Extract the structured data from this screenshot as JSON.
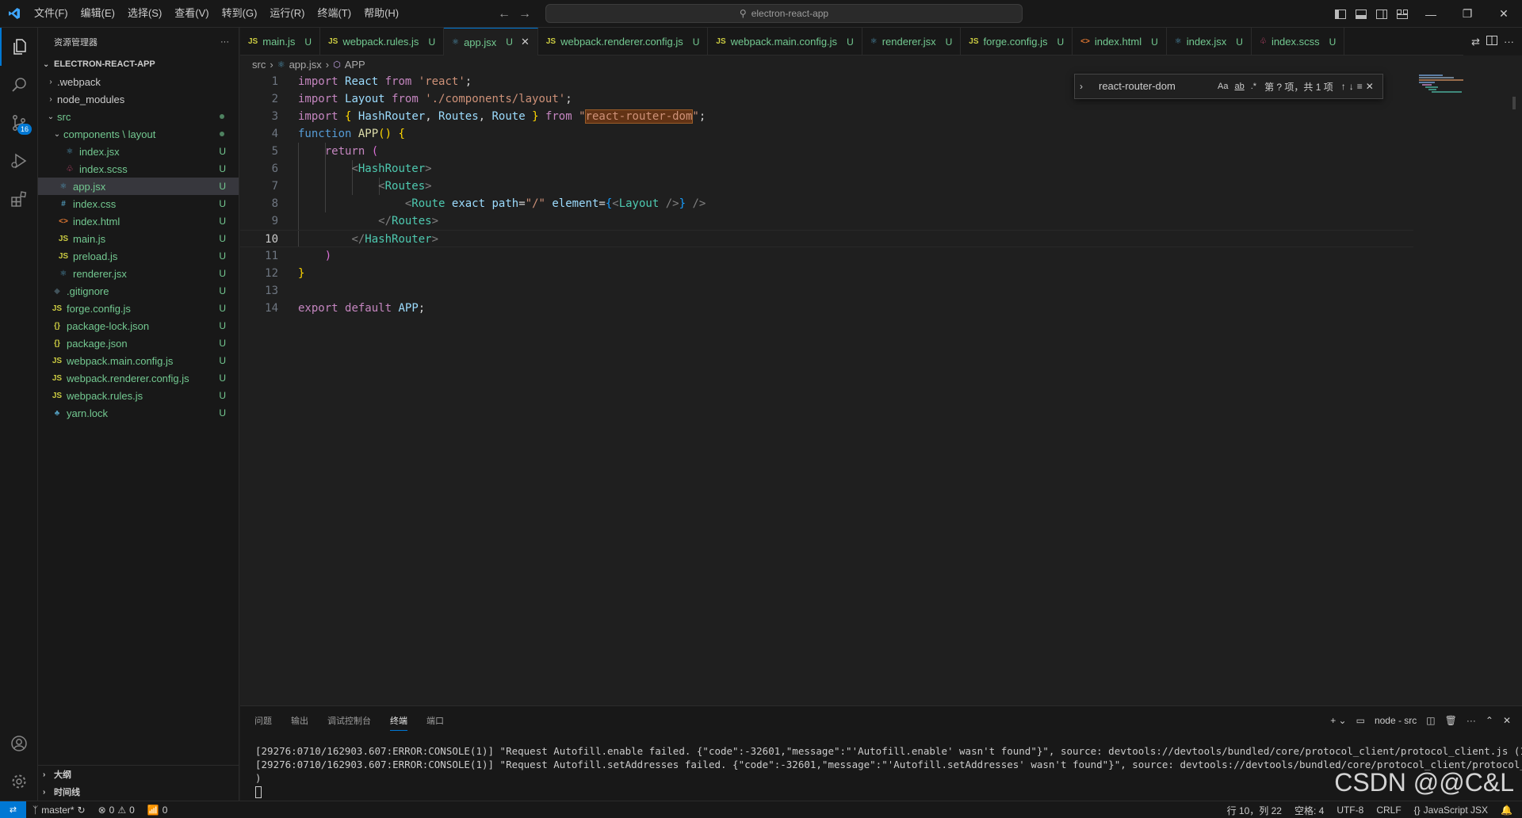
{
  "titlebar": {
    "menu": [
      "文件(F)",
      "编辑(E)",
      "选择(S)",
      "查看(V)",
      "转到(G)",
      "运行(R)",
      "终端(T)",
      "帮助(H)"
    ],
    "search": "electron-react-app"
  },
  "activity": {
    "source_control_badge": "16"
  },
  "sidebar": {
    "title": "资源管理器",
    "more": "···",
    "root": "ELECTRON-REACT-APP",
    "items": [
      {
        "name": ".webpack",
        "type": "folder",
        "open": false,
        "indent": 0,
        "status": ""
      },
      {
        "name": "node_modules",
        "type": "folder",
        "open": false,
        "indent": 0,
        "status": ""
      },
      {
        "name": "src",
        "type": "folder",
        "open": true,
        "indent": 0,
        "status": "dot"
      },
      {
        "name": "components \\ layout",
        "type": "folder",
        "open": true,
        "indent": 1,
        "status": "dot"
      },
      {
        "name": "index.jsx",
        "type": "react",
        "indent": 2,
        "status": "U"
      },
      {
        "name": "index.scss",
        "type": "scss",
        "indent": 2,
        "status": "U"
      },
      {
        "name": "app.jsx",
        "type": "react",
        "indent": 1,
        "status": "U",
        "selected": true
      },
      {
        "name": "index.css",
        "type": "css",
        "indent": 1,
        "status": "U"
      },
      {
        "name": "index.html",
        "type": "html",
        "indent": 1,
        "status": "U"
      },
      {
        "name": "main.js",
        "type": "js",
        "indent": 1,
        "status": "U"
      },
      {
        "name": "preload.js",
        "type": "js",
        "indent": 1,
        "status": "U"
      },
      {
        "name": "renderer.jsx",
        "type": "react",
        "indent": 1,
        "status": "U"
      },
      {
        "name": ".gitignore",
        "type": "git",
        "indent": 0,
        "status": "U"
      },
      {
        "name": "forge.config.js",
        "type": "js",
        "indent": 0,
        "status": "U"
      },
      {
        "name": "package-lock.json",
        "type": "json",
        "indent": 0,
        "status": "U"
      },
      {
        "name": "package.json",
        "type": "json",
        "indent": 0,
        "status": "U"
      },
      {
        "name": "webpack.main.config.js",
        "type": "js",
        "indent": 0,
        "status": "U"
      },
      {
        "name": "webpack.renderer.config.js",
        "type": "js",
        "indent": 0,
        "status": "U"
      },
      {
        "name": "webpack.rules.js",
        "type": "js",
        "indent": 0,
        "status": "U"
      },
      {
        "name": "yarn.lock",
        "type": "yarn",
        "indent": 0,
        "status": "U"
      }
    ],
    "outline": "大纲",
    "timeline": "时间线"
  },
  "tabs": [
    {
      "label": "main.js",
      "type": "js",
      "status": "U"
    },
    {
      "label": "webpack.rules.js",
      "type": "js",
      "status": "U"
    },
    {
      "label": "app.jsx",
      "type": "react",
      "status": "U",
      "active": true
    },
    {
      "label": "webpack.renderer.config.js",
      "type": "js",
      "status": "U"
    },
    {
      "label": "webpack.main.config.js",
      "type": "js",
      "status": "U"
    },
    {
      "label": "renderer.jsx",
      "type": "react",
      "status": "U"
    },
    {
      "label": "forge.config.js",
      "type": "js",
      "status": "U"
    },
    {
      "label": "index.html",
      "type": "html",
      "status": "U"
    },
    {
      "label": "index.jsx",
      "type": "react",
      "status": "U"
    },
    {
      "label": "index.scss",
      "type": "scss",
      "status": "U"
    }
  ],
  "breadcrumb": [
    "src",
    "app.jsx",
    "APP"
  ],
  "code": {
    "current_line": 10,
    "lines": [
      [
        [
          "kw2",
          "import"
        ],
        [
          "pl",
          " "
        ],
        [
          "id",
          "React"
        ],
        [
          "pl",
          " "
        ],
        [
          "kw2",
          "from"
        ],
        [
          "pl",
          " "
        ],
        [
          "str",
          "'react'"
        ],
        [
          "pl",
          ";"
        ]
      ],
      [
        [
          "kw2",
          "import"
        ],
        [
          "pl",
          " "
        ],
        [
          "id",
          "Layout"
        ],
        [
          "pl",
          " "
        ],
        [
          "kw2",
          "from"
        ],
        [
          "pl",
          " "
        ],
        [
          "str",
          "'./components/layout'"
        ],
        [
          "pl",
          ";"
        ]
      ],
      [
        [
          "kw2",
          "import"
        ],
        [
          "pl",
          " "
        ],
        [
          "p1",
          "{"
        ],
        [
          "pl",
          " "
        ],
        [
          "id",
          "HashRouter"
        ],
        [
          "pl",
          ", "
        ],
        [
          "id",
          "Routes"
        ],
        [
          "pl",
          ", "
        ],
        [
          "id",
          "Route"
        ],
        [
          "pl",
          " "
        ],
        [
          "p1",
          "}"
        ],
        [
          "pl",
          " "
        ],
        [
          "kw2",
          "from"
        ],
        [
          "pl",
          " "
        ],
        [
          "str",
          "\""
        ],
        [
          "strhl",
          "react-router-dom"
        ],
        [
          "str",
          "\""
        ],
        [
          "pl",
          ";"
        ]
      ],
      [
        [
          "kw",
          "function"
        ],
        [
          "pl",
          " "
        ],
        [
          "fn",
          "APP"
        ],
        [
          "p1",
          "()"
        ],
        [
          "pl",
          " "
        ],
        [
          "p1",
          "{"
        ]
      ],
      [
        [
          "pl",
          "    "
        ],
        [
          "kw2",
          "return"
        ],
        [
          "pl",
          " "
        ],
        [
          "p2",
          "("
        ]
      ],
      [
        [
          "pl",
          "        "
        ],
        [
          "br",
          "<"
        ],
        [
          "tag",
          "HashRouter"
        ],
        [
          "br",
          ">"
        ]
      ],
      [
        [
          "pl",
          "            "
        ],
        [
          "br",
          "<"
        ],
        [
          "tag",
          "Routes"
        ],
        [
          "br",
          ">"
        ]
      ],
      [
        [
          "pl",
          "                "
        ],
        [
          "br",
          "<"
        ],
        [
          "tag",
          "Route"
        ],
        [
          "pl",
          " "
        ],
        [
          "attr",
          "exact"
        ],
        [
          "pl",
          " "
        ],
        [
          "attr",
          "path"
        ],
        [
          "pl",
          "="
        ],
        [
          "str",
          "\"/\""
        ],
        [
          "pl",
          " "
        ],
        [
          "attr",
          "element"
        ],
        [
          "pl",
          "="
        ],
        [
          "p3",
          "{"
        ],
        [
          "br",
          "<"
        ],
        [
          "tag",
          "Layout"
        ],
        [
          "pl",
          " "
        ],
        [
          "br",
          "/>"
        ],
        [
          "p3",
          "}"
        ],
        [
          "pl",
          " "
        ],
        [
          "br",
          "/>"
        ]
      ],
      [
        [
          "pl",
          "            "
        ],
        [
          "br",
          "</"
        ],
        [
          "tag",
          "Routes"
        ],
        [
          "br",
          ">"
        ]
      ],
      [
        [
          "pl",
          "        "
        ],
        [
          "br",
          "</"
        ],
        [
          "tag",
          "HashRouter"
        ],
        [
          "br",
          ">"
        ]
      ],
      [
        [
          "pl",
          "    "
        ],
        [
          "p2",
          ")"
        ]
      ],
      [
        [
          "p1",
          "}"
        ]
      ],
      [],
      [
        [
          "kw2",
          "export"
        ],
        [
          "pl",
          " "
        ],
        [
          "kw2",
          "default"
        ],
        [
          "pl",
          " "
        ],
        [
          "id",
          "APP"
        ],
        [
          "pl",
          ";"
        ]
      ]
    ]
  },
  "find": {
    "query": "react-router-dom",
    "opt_case": "Aa",
    "opt_word": "ab",
    "opt_regex": ".*",
    "result": "第 ? 项，共 1 项"
  },
  "panel": {
    "tabs": [
      "问题",
      "输出",
      "调试控制台",
      "终端",
      "端口"
    ],
    "active_tab": "终端",
    "terminal_name": "node - src",
    "terminal_lines": [
      "[29276:0710/162903.607:ERROR:CONSOLE(1)] \"Request Autofill.enable failed. {\"code\":-32601,\"message\":\"'Autofill.enable' wasn't found\"}\", source: devtools://devtools/bundled/core/protocol_client/protocol_client.js (1)",
      "[29276:0710/162903.607:ERROR:CONSOLE(1)] \"Request Autofill.setAddresses failed. {\"code\":-32601,\"message\":\"'Autofill.setAddresses' wasn't found\"}\", source: devtools://devtools/bundled/core/protocol_client/protocol_client.js (1",
      ")"
    ],
    "watermark": "CSDN @@C&L"
  },
  "statusbar": {
    "branch": "master*",
    "errors": "0",
    "warnings": "0",
    "ports": "0",
    "position": "行 10，列 22",
    "spaces": "空格: 4",
    "encoding": "UTF-8",
    "eol": "CRLF",
    "language": "JavaScript JSX"
  }
}
